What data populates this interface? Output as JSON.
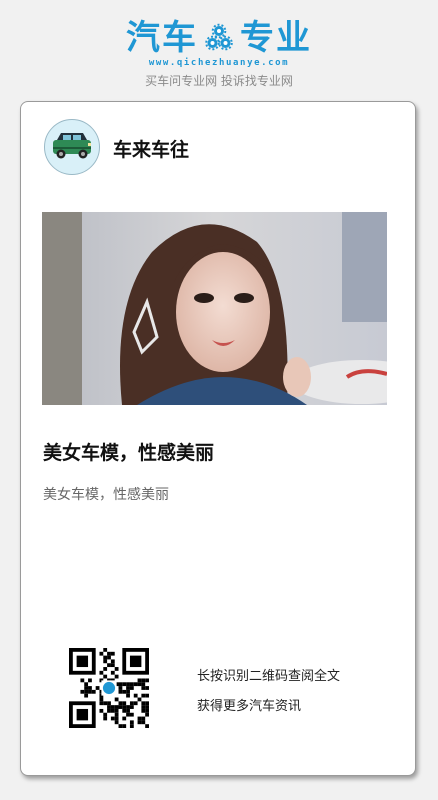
{
  "brand": {
    "logo_part1": "汽车",
    "logo_part2": "专业",
    "url": "www.qichezhuanye.com",
    "tagline": "买车问专业网 投诉找专业网",
    "accent_color": "#1f97d4"
  },
  "author": {
    "name": "车来车往",
    "avatar_icon": "green-car-icon"
  },
  "article": {
    "cover_image": "model-portrait-photo",
    "title": "美女车模，性感美丽",
    "summary": "美女车模，性感美丽"
  },
  "footer": {
    "qr_icon": "qr-code-icon",
    "hint_line1": "长按识别二维码查阅全文",
    "hint_line2": "获得更多汽车资讯"
  }
}
